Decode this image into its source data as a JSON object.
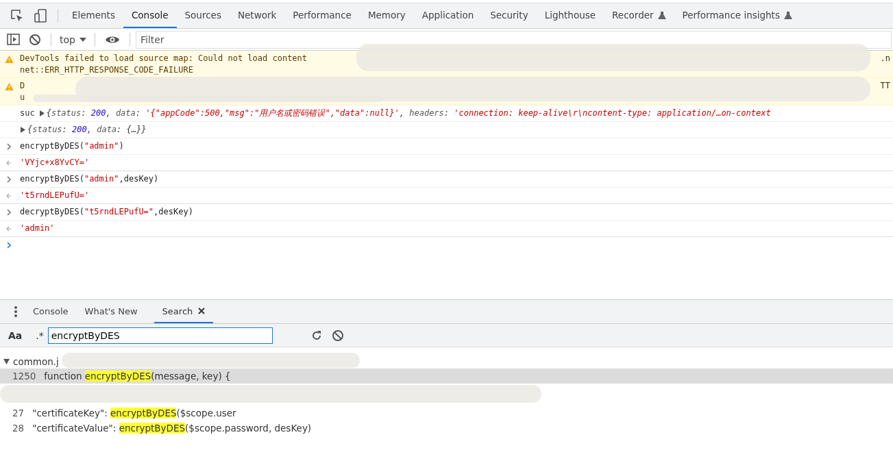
{
  "main_tabs": [
    {
      "label": "Elements",
      "selected": false
    },
    {
      "label": "Console",
      "selected": true
    },
    {
      "label": "Sources",
      "selected": false
    },
    {
      "label": "Network",
      "selected": false
    },
    {
      "label": "Performance",
      "selected": false
    },
    {
      "label": "Memory",
      "selected": false
    },
    {
      "label": "Application",
      "selected": false
    },
    {
      "label": "Security",
      "selected": false
    },
    {
      "label": "Lighthouse",
      "selected": false
    },
    {
      "label": "Recorder",
      "selected": false,
      "experimental": true
    },
    {
      "label": "Performance insights",
      "selected": false,
      "experimental": true
    }
  ],
  "console_toolbar": {
    "context": "top",
    "filter": {
      "placeholder": "Filter"
    }
  },
  "messages": [
    {
      "kind": "warning",
      "lines": [
        "DevTools failed to load source map: Could not load content",
        "net::ERR_HTTP_RESPONSE_CODE_FAILURE"
      ],
      "tail": ".n"
    },
    {
      "kind": "warning",
      "lines": [
        "D",
        "u"
      ],
      "tail": "TT"
    },
    {
      "kind": "log",
      "prefix": "suc",
      "expanded": false,
      "tokens": [
        {
          "kind": "punct",
          "text": "{"
        },
        {
          "kind": "key",
          "text": "status"
        },
        {
          "kind": "punct",
          "text": ": "
        },
        {
          "kind": "num",
          "text": "200"
        },
        {
          "kind": "punct",
          "text": ", "
        },
        {
          "kind": "key",
          "text": "data"
        },
        {
          "kind": "punct",
          "text": ": "
        },
        {
          "kind": "str",
          "text": "'{\"appCode\":500,\"msg\":\"用户名或密码错误\",\"data\":null}'"
        },
        {
          "kind": "punct",
          "text": ", "
        },
        {
          "kind": "key",
          "text": "headers"
        },
        {
          "kind": "punct",
          "text": ": "
        },
        {
          "kind": "str",
          "text": "'connection: keep-alive\\r\\ncontent-type: application/…on-context"
        }
      ]
    },
    {
      "kind": "log",
      "expanded": false,
      "tokens": [
        {
          "kind": "punct",
          "text": "{"
        },
        {
          "kind": "key",
          "text": "status"
        },
        {
          "kind": "punct",
          "text": ": "
        },
        {
          "kind": "num",
          "text": "200"
        },
        {
          "kind": "punct",
          "text": ", "
        },
        {
          "kind": "key",
          "text": "data"
        },
        {
          "kind": "punct",
          "text": ": {…}}"
        }
      ]
    },
    {
      "kind": "input",
      "tokens": [
        {
          "kind": "plain",
          "text": "encryptByDES("
        },
        {
          "kind": "str",
          "text": "\"admin\""
        },
        {
          "kind": "plain",
          "text": ")"
        }
      ]
    },
    {
      "kind": "result",
      "tokens": [
        {
          "kind": "str",
          "text": "'VYjc+x8YvCY='"
        }
      ]
    },
    {
      "kind": "input",
      "tokens": [
        {
          "kind": "plain",
          "text": "encryptByDES("
        },
        {
          "kind": "str",
          "text": "\"admin\""
        },
        {
          "kind": "plain",
          "text": ",desKey)"
        }
      ]
    },
    {
      "kind": "result",
      "tokens": [
        {
          "kind": "str",
          "text": "'t5rndLEPufU='"
        }
      ]
    },
    {
      "kind": "input",
      "tokens": [
        {
          "kind": "plain",
          "text": "decryptByDES("
        },
        {
          "kind": "str",
          "text": "\"t5rndLEPufU=\""
        },
        {
          "kind": "plain",
          "text": ",desKey)"
        }
      ]
    },
    {
      "kind": "result",
      "tokens": [
        {
          "kind": "str",
          "text": "'admin'"
        }
      ]
    },
    {
      "kind": "prompt"
    }
  ],
  "drawer_tabs": [
    {
      "label": "Console",
      "selected": false
    },
    {
      "label": "What's New",
      "selected": false
    },
    {
      "label": "Search",
      "selected": true,
      "closable": true
    }
  ],
  "search": {
    "case_toggle": "Aa",
    "regex_toggle": ".*",
    "value": "encryptByDES"
  },
  "results": [
    {
      "file": "common.j",
      "expanded": true,
      "matches": [
        {
          "line": "1250",
          "selected": true,
          "parts": [
            {
              "text": "function ",
              "match": false
            },
            {
              "text": "encryptByDES",
              "match": true
            },
            {
              "text": "(message, key) {",
              "match": false
            }
          ]
        }
      ]
    },
    {
      "matches": [
        {
          "line": "27",
          "selected": false,
          "parts": [
            {
              "text": "\"certificateKey\": ",
              "match": false
            },
            {
              "text": "encryptByDES",
              "match": true
            },
            {
              "text": "($scope.user",
              "match": false
            }
          ]
        },
        {
          "line": "28",
          "selected": false,
          "parts": [
            {
              "text": "\"certificateValue\": ",
              "match": false
            },
            {
              "text": "encryptByDES",
              "match": true
            },
            {
              "text": "($scope.password, desKey)",
              "match": false
            }
          ]
        }
      ]
    }
  ]
}
